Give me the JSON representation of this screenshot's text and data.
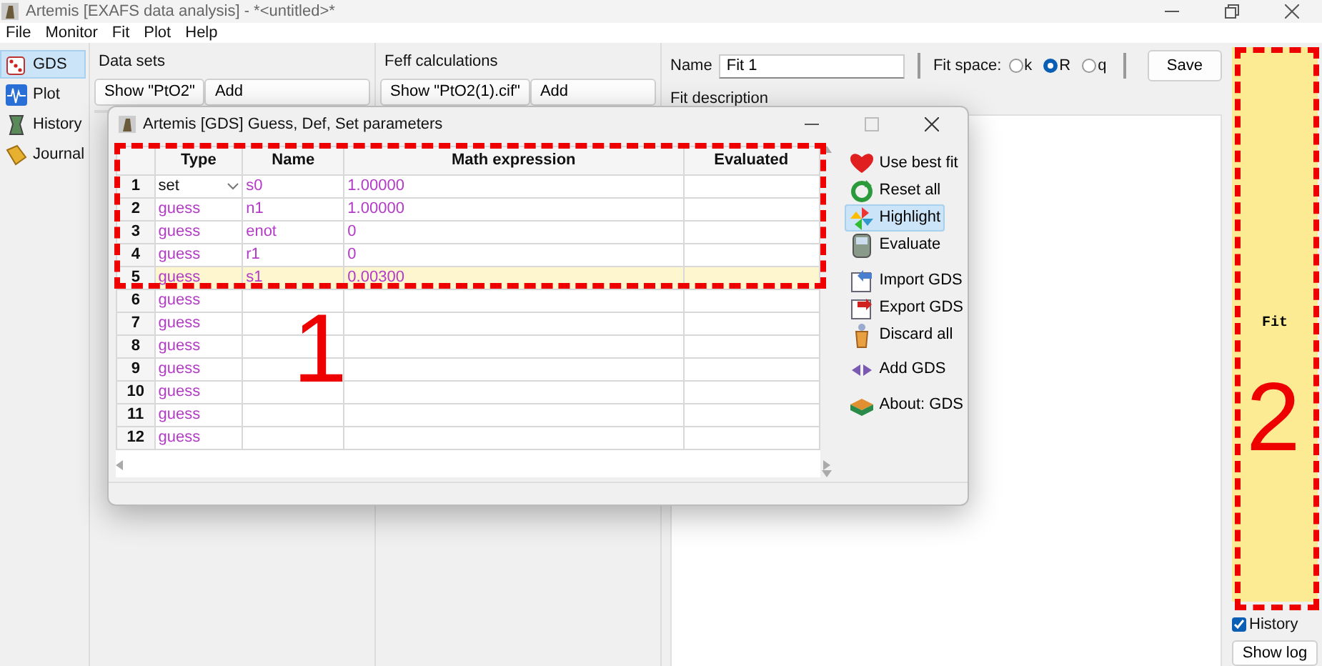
{
  "window": {
    "title": "Artemis [EXAFS data analysis] - *<untitled>*"
  },
  "menu": [
    "File",
    "Monitor",
    "Fit",
    "Plot",
    "Help"
  ],
  "sidebar": [
    {
      "label": "GDS",
      "selected": true
    },
    {
      "label": "Plot",
      "selected": false
    },
    {
      "label": "History",
      "selected": false
    },
    {
      "label": "Journal",
      "selected": false
    }
  ],
  "data_sets": {
    "title": "Data sets",
    "buttons": [
      "Show \"PtO2\"",
      "Add"
    ]
  },
  "feff_calculations": {
    "title": "Feff calculations",
    "buttons": [
      "Show \"PtO2(1).cif\"",
      "Add"
    ]
  },
  "fit": {
    "name_label": "Name",
    "name_value": "Fit 1",
    "fit_space_label": "Fit space:",
    "fit_space_options": [
      {
        "label": "k",
        "selected": false
      },
      {
        "label": "R",
        "selected": true
      },
      {
        "label": "q",
        "selected": false
      }
    ],
    "save_button": "Save",
    "description_label": "Fit description"
  },
  "fit_button": "Fit",
  "history": {
    "label": "History",
    "checked": true
  },
  "show_log_button": "Show log",
  "dialog": {
    "title": "Artemis [GDS] Guess, Def, Set parameters",
    "columns": [
      "Type",
      "Name",
      "Math expression",
      "Evaluated"
    ],
    "rows": [
      {
        "number": "1",
        "kind": "dropdown",
        "type": "set",
        "name": "s0",
        "math_expression": "1.00000",
        "selected": false
      },
      {
        "number": "2",
        "kind": "text",
        "type": "guess",
        "name": "n1",
        "math_expression": "1.00000",
        "selected": false
      },
      {
        "number": "3",
        "kind": "text",
        "type": "guess",
        "name": "enot",
        "math_expression": "0",
        "selected": false
      },
      {
        "number": "4",
        "kind": "text",
        "type": "guess",
        "name": "r1",
        "math_expression": "0",
        "selected": false
      },
      {
        "number": "5",
        "kind": "text",
        "type": "guess",
        "name": "s1",
        "math_expression": "0.00300",
        "selected": true
      },
      {
        "number": "6",
        "kind": "text",
        "type": "guess",
        "selected": false
      },
      {
        "number": "7",
        "kind": "text",
        "type": "guess",
        "selected": false
      },
      {
        "number": "8",
        "kind": "text",
        "type": "guess",
        "selected": false
      },
      {
        "number": "9",
        "kind": "text",
        "type": "guess",
        "selected": false
      },
      {
        "number": "10",
        "kind": "text",
        "type": "guess",
        "selected": false
      },
      {
        "number": "11",
        "kind": "text",
        "type": "guess",
        "selected": false
      },
      {
        "number": "12",
        "kind": "text",
        "type": "guess",
        "selected": false
      }
    ],
    "actions": [
      {
        "label": "Use best fit",
        "selected": false
      },
      {
        "label": "Reset all",
        "selected": false
      },
      {
        "label": "Highlight",
        "selected": true
      },
      {
        "label": "Evaluate",
        "selected": false
      },
      {
        "label": "Import GDS",
        "selected": false
      },
      {
        "label": "Export GDS",
        "selected": false
      },
      {
        "label": "Discard all",
        "selected": false
      },
      {
        "label": "Add GDS",
        "selected": false
      },
      {
        "label": "About: GDS",
        "selected": false
      }
    ]
  },
  "annotations": [
    {
      "label": "1"
    },
    {
      "label": "2"
    }
  ]
}
